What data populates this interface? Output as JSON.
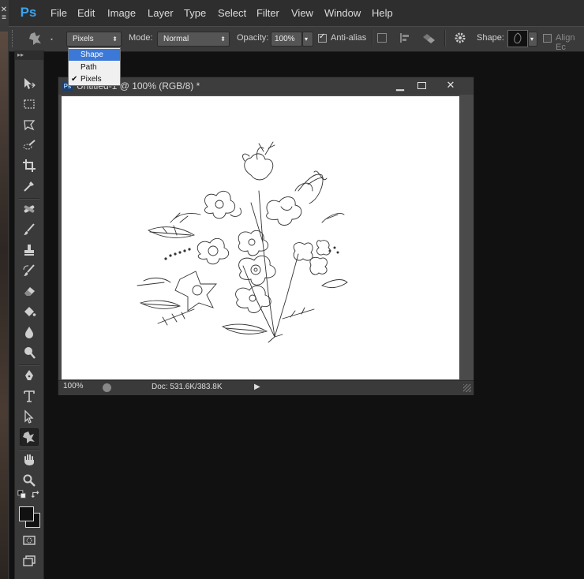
{
  "menubar": {
    "logo": "Ps",
    "items": [
      "File",
      "Edit",
      "Image",
      "Layer",
      "Type",
      "Select",
      "Filter",
      "View",
      "Window",
      "Help"
    ]
  },
  "options": {
    "mode_select_value": "Pixels",
    "mode_label": "Mode:",
    "mode_value": "Normal",
    "opacity_label": "Opacity:",
    "opacity_value": "100%",
    "antialias_label": "Anti-alias",
    "antialias_checked": true,
    "shape_label": "Shape:",
    "align_label": "Align Ec"
  },
  "dropdown": {
    "items": [
      {
        "label": "Shape",
        "selected": true,
        "checked": false
      },
      {
        "label": "Path",
        "selected": false,
        "checked": false
      },
      {
        "label": "Pixels",
        "selected": false,
        "checked": true
      }
    ]
  },
  "document": {
    "title": "Untitled-1 @ 100% (RGB/8) *",
    "ps_icon": "Ps",
    "zoom": "100%",
    "doc_info": "Doc: 531.6K/383.8K"
  },
  "tools": [
    "move-tool-icon",
    "marquee-tool-icon",
    "lasso-tool-icon",
    "quick-selection-icon",
    "crop-tool-icon",
    "eyedropper-icon",
    "healing-brush-icon",
    "brush-tool-icon",
    "clone-stamp-icon",
    "history-brush-icon",
    "eraser-icon",
    "paint-bucket-icon",
    "blur-tool-icon",
    "dodge-tool-icon",
    "pen-tool-icon",
    "type-tool-icon",
    "path-selection-icon",
    "custom-shape-icon",
    "hand-tool-icon",
    "zoom-tool-icon",
    "default-colors-icon",
    "swap-colors-icon",
    "foreground-color-swatch",
    "quick-mask-icon",
    "screen-mode-icon"
  ],
  "colors": {
    "app_bg": "#111111",
    "menubar": "#2e2e2e",
    "panel": "#3a3a3a",
    "dropdown_highlight": "#3b78d8",
    "ps_logo": "#3aa4f0"
  }
}
